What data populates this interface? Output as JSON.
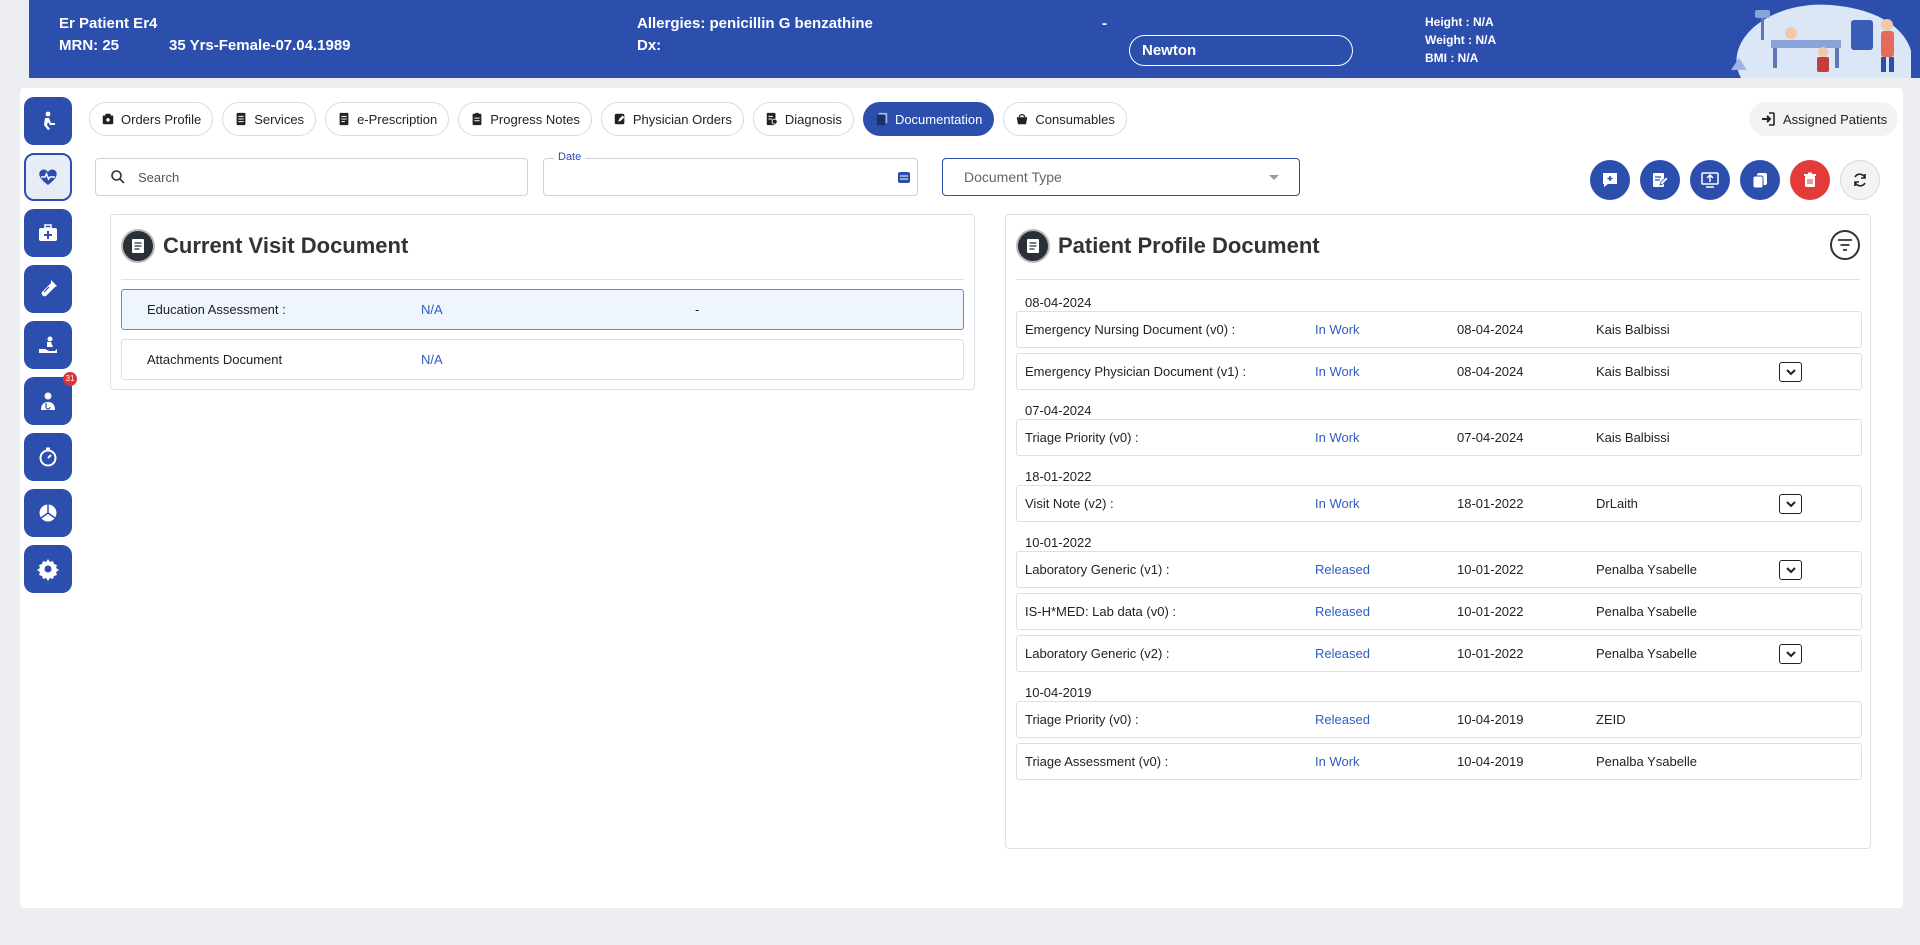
{
  "header": {
    "patient_name": "Er Patient Er4",
    "mrn": "MRN: 25",
    "demographics": "35 Yrs-Female-07.04.1989",
    "allergies": "Allergies: penicillin G benzathine",
    "dx": "Dx:",
    "dash": "-",
    "location_value": "Newton",
    "height": "Height : N/A",
    "weight": "Weight : N/A",
    "bmi": "BMI : N/A"
  },
  "sidebar": {
    "badge_count": "31"
  },
  "tabs": [
    {
      "label": "Orders Profile",
      "icon": "box-icon"
    },
    {
      "label": "Services",
      "icon": "list-icon"
    },
    {
      "label": "e-Prescription",
      "icon": "prescription-icon"
    },
    {
      "label": "Progress Notes",
      "icon": "clipboard-icon"
    },
    {
      "label": "Physician Orders",
      "icon": "edit-icon"
    },
    {
      "label": "Diagnosis",
      "icon": "diagnosis-icon"
    },
    {
      "label": "Documentation",
      "icon": "documents-icon",
      "active": true
    },
    {
      "label": "Consumables",
      "icon": "basket-icon"
    }
  ],
  "assigned_patients": "Assigned Patients",
  "filters": {
    "search_placeholder": "Search",
    "date_label": "Date",
    "doc_type_placeholder": "Document Type"
  },
  "current_visit": {
    "title": "Current Visit Document",
    "rows": [
      {
        "name": "Education Assessment :",
        "value": "N/A",
        "extra": "-"
      },
      {
        "name": "Attachments Document",
        "value": "N/A",
        "extra": ""
      }
    ]
  },
  "patient_profile": {
    "title": "Patient Profile Document",
    "groups": [
      {
        "date": "08-04-2024",
        "rows": [
          {
            "name": "Emergency Nursing Document (v0) :",
            "status": "In Work",
            "date": "08-04-2024",
            "user": "Kais Balbissi",
            "expand": false
          },
          {
            "name": "Emergency Physician Document (v1) :",
            "status": "In Work",
            "date": "08-04-2024",
            "user": "Kais Balbissi",
            "expand": true
          }
        ]
      },
      {
        "date": "07-04-2024",
        "rows": [
          {
            "name": "Triage Priority (v0) :",
            "status": "In Work",
            "date": "07-04-2024",
            "user": "Kais Balbissi",
            "expand": false
          }
        ]
      },
      {
        "date": "18-01-2022",
        "rows": [
          {
            "name": "Visit Note (v2) :",
            "status": "In Work",
            "date": "18-01-2022",
            "user": "DrLaith",
            "expand": true
          }
        ]
      },
      {
        "date": "10-01-2022",
        "rows": [
          {
            "name": "Laboratory Generic (v1) :",
            "status": "Released",
            "date": "10-01-2022",
            "user": "Penalba Ysabelle",
            "expand": true
          },
          {
            "name": "IS-H*MED: Lab data (v0) :",
            "status": "Released",
            "date": "10-01-2022",
            "user": "Penalba Ysabelle",
            "expand": false
          },
          {
            "name": "Laboratory Generic (v2) :",
            "status": "Released",
            "date": "10-01-2022",
            "user": "Penalba Ysabelle",
            "expand": true
          }
        ]
      },
      {
        "date": "10-04-2019",
        "rows": [
          {
            "name": "Triage Priority (v0) :",
            "status": "Released",
            "date": "10-04-2019",
            "user": "ZEID",
            "expand": false
          },
          {
            "name": "Triage Assessment (v0) :",
            "status": "In Work",
            "date": "10-04-2019",
            "user": "Penalba Ysabelle",
            "expand": false
          }
        ]
      }
    ]
  }
}
